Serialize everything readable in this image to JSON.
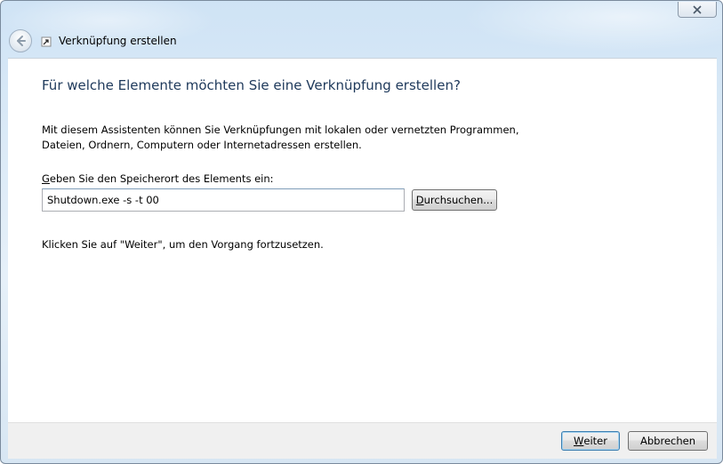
{
  "window": {
    "title": "Verknüpfung erstellen"
  },
  "main": {
    "heading": "Für welche Elemente möchten Sie eine Verknüpfung erstellen?",
    "description": "Mit diesem Assistenten können Sie Verknüpfungen mit lokalen oder vernetzten Programmen, Dateien, Ordnern, Computern oder Internetadressen erstellen.",
    "location_label_accel": "G",
    "location_label_rest": "eben Sie den Speicherort des Elements ein:",
    "location_value": "Shutdown.exe -s -t 00",
    "browse_accel": "D",
    "browse_rest": "urchsuchen...",
    "hint": "Klicken Sie auf \"Weiter\", um den Vorgang fortzusetzen."
  },
  "footer": {
    "next_accel": "W",
    "next_rest": "eiter",
    "cancel_label": "Abbrechen"
  },
  "icons": {
    "back": "back-arrow-icon",
    "close": "close-icon",
    "shortcut": "shortcut-icon"
  },
  "colors": {
    "heading": "#1e395b",
    "default_button_border": "#3c7fb1"
  }
}
